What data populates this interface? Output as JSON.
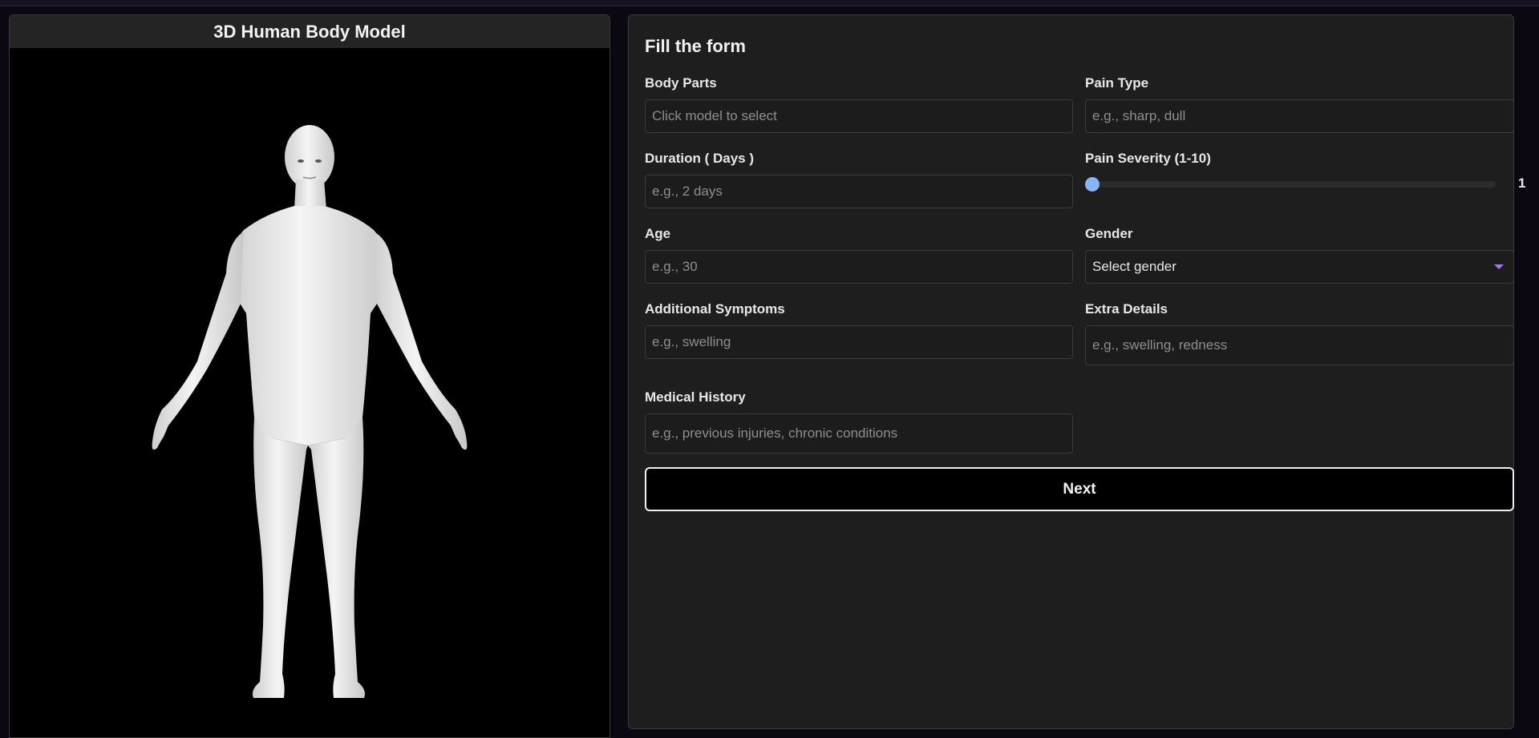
{
  "model_panel": {
    "title": "3D Human Body Model"
  },
  "form": {
    "title": "Fill the form",
    "body_parts": {
      "label": "Body Parts",
      "placeholder": "Click model to select",
      "value": ""
    },
    "pain_type": {
      "label": "Pain Type",
      "placeholder": "e.g., sharp, dull",
      "value": ""
    },
    "duration": {
      "label": "Duration ( Days )",
      "placeholder": "e.g., 2 days",
      "value": ""
    },
    "severity": {
      "label": "Pain Severity (1-10)",
      "value": "1",
      "min": 1,
      "max": 10
    },
    "age": {
      "label": "Age",
      "placeholder": "e.g., 30",
      "value": ""
    },
    "gender": {
      "label": "Gender",
      "selected": "Select gender"
    },
    "additional_symptoms": {
      "label": "Additional Symptoms",
      "placeholder": "e.g., swelling",
      "value": ""
    },
    "extra_details": {
      "label": "Extra Details",
      "placeholder": "e.g., swelling, redness",
      "value": ""
    },
    "medical_history": {
      "label": "Medical History",
      "placeholder": "e.g., previous injuries, chronic conditions",
      "value": ""
    },
    "next_label": "Next"
  },
  "colors": {
    "accent_thumb": "#8ab4f8",
    "caret": "#a878e0",
    "panel_bg": "#1e1e1e",
    "model_bg": "#000000"
  }
}
